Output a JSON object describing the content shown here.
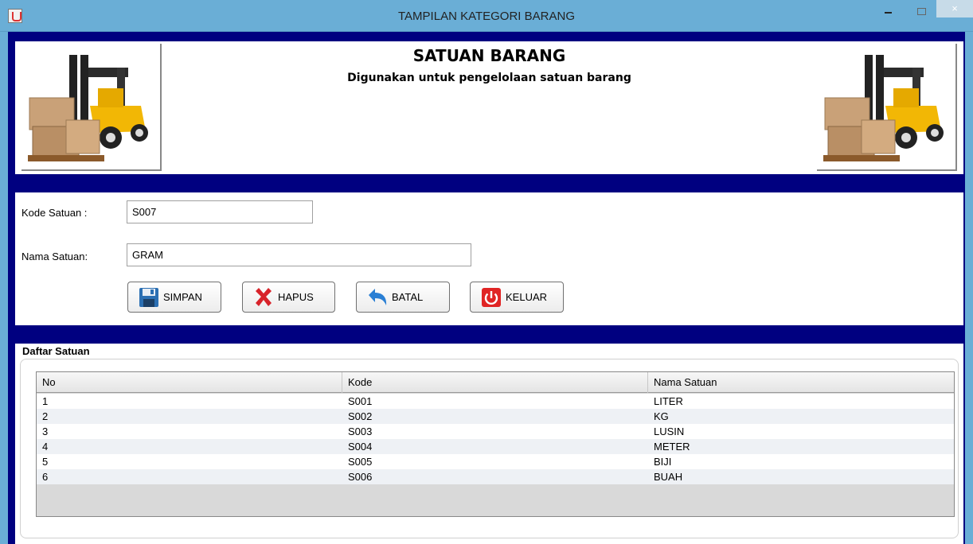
{
  "window": {
    "title": "TAMPILAN KATEGORI BARANG",
    "close_symbol": "×"
  },
  "header": {
    "title": "SATUAN BARANG",
    "subtitle": "Digunakan untuk pengelolaan satuan barang",
    "image_icon": "forklift-boxes-icon"
  },
  "form": {
    "kode_label": "Kode Satuan :",
    "kode_value": "S007",
    "nama_label": "Nama Satuan:",
    "nama_value": "GRAM"
  },
  "buttons": {
    "simpan": "SIMPAN",
    "hapus": "HAPUS",
    "batal": "BATAL",
    "keluar": "KELUAR"
  },
  "table": {
    "section_title": "Daftar Satuan",
    "columns": [
      "No",
      "Kode",
      "Nama Satuan"
    ],
    "rows": [
      [
        "1",
        "S001",
        "LITER"
      ],
      [
        "2",
        "S002",
        "KG"
      ],
      [
        "3",
        "S003",
        "LUSIN"
      ],
      [
        "4",
        "S004",
        "METER"
      ],
      [
        "5",
        "S005",
        "BIJI"
      ],
      [
        "6",
        "S006",
        "BUAH"
      ]
    ]
  },
  "colors": {
    "frame": "#000080",
    "titlebar": "#6aaed6"
  }
}
